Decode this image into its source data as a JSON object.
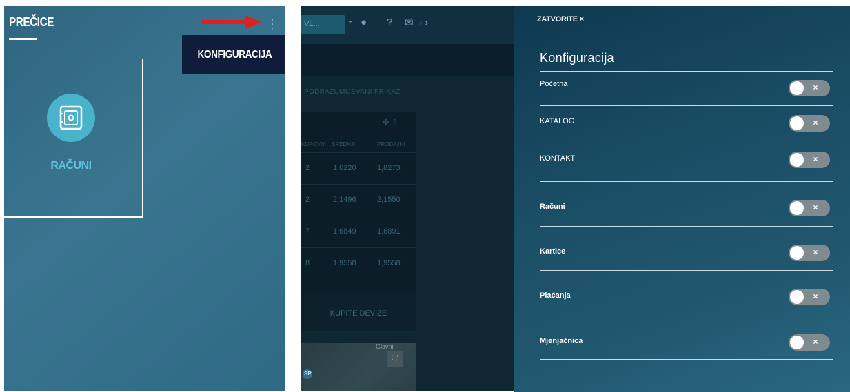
{
  "left_panel": {
    "title": "PREČICE",
    "menu_label": "KONFIGURACIJA",
    "card_label": "RAČUNI",
    "colors": {
      "arrow": "#e02020",
      "card_icon_bg": "#4ab3cc",
      "menu_bg": "#0f1d3a"
    }
  },
  "middle_background": {
    "dropdown_text": "VL...",
    "crumb": "PODRAZUMIJEVANI PRIKAZ",
    "columns": [
      "KUPOVNI",
      "SREDNJI",
      "PRODAJNI"
    ],
    "rows": [
      {
        "a": "2",
        "b": "1,0220",
        "c": "1,8273"
      },
      {
        "a": "2",
        "b": "2,1496",
        "c": "2,1550"
      },
      {
        "a": "7",
        "b": "1,6849",
        "c": "1,6891"
      },
      {
        "a": "8",
        "b": "1,9558",
        "c": "1,9558"
      }
    ],
    "button_label": "KUPITE DEVIZE",
    "map_label": "Glavni",
    "map_pin": "SP"
  },
  "config_panel": {
    "close_label": "ZATVORITE ×",
    "heading": "Konfiguracija",
    "items": [
      {
        "label": "Početna",
        "enabled": false
      },
      {
        "label": "KATALOG",
        "enabled": false
      },
      {
        "label": "KONTAKT",
        "enabled": false
      },
      {
        "label": "Računi",
        "enabled": false
      },
      {
        "label": "Kartice",
        "enabled": false
      },
      {
        "label": "Plaćanja",
        "enabled": false
      },
      {
        "label": "Mjenjačnica",
        "enabled": false
      }
    ],
    "toggle_symbol": "×"
  }
}
